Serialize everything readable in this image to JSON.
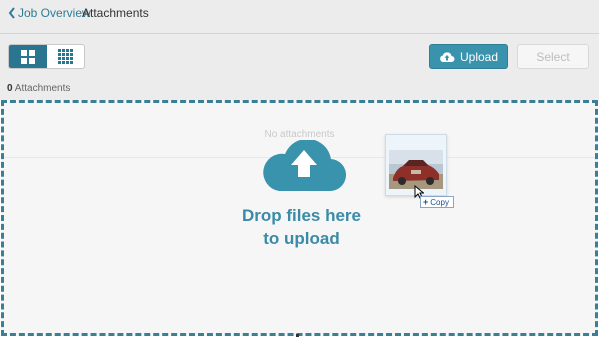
{
  "breadcrumb": {
    "back_label": "Job Overview",
    "current_label": "Attachments"
  },
  "toolbar": {
    "view_toggle": {
      "active": "grid-large",
      "options": [
        "grid-large-icon",
        "grid-small-icon"
      ]
    },
    "upload_label": "Upload",
    "select_label": "Select"
  },
  "attachments": {
    "count": "0",
    "count_label": " Attachments"
  },
  "dropzone": {
    "empty_text": "No attachments",
    "drop_line1": "Drop files here",
    "drop_line2": "to upload"
  },
  "drag": {
    "copy_label": "Copy"
  },
  "colors": {
    "accent": "#3a93ad",
    "accent_dark": "#2a7590",
    "border": "#3a7f96",
    "text_accent": "#3a8aa8"
  }
}
